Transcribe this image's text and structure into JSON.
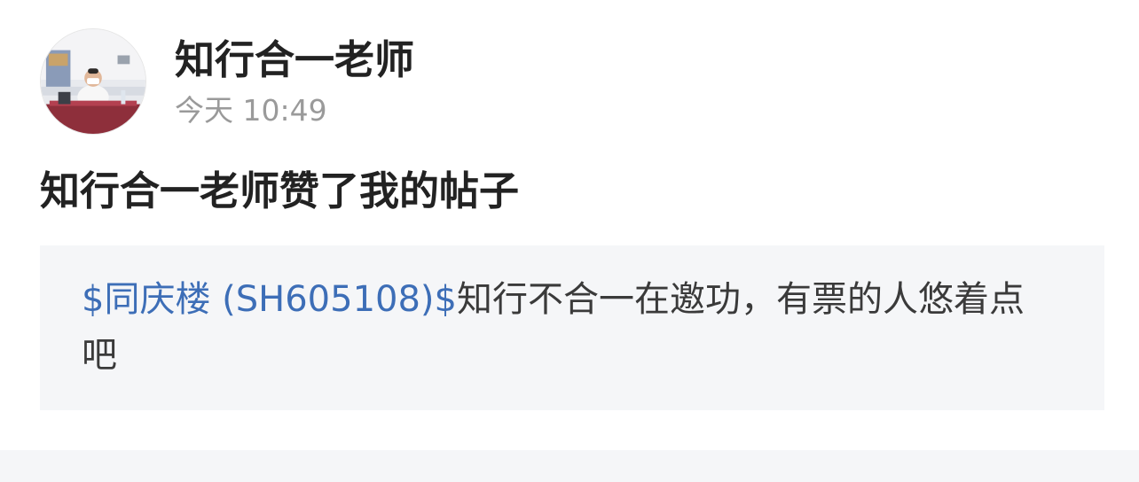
{
  "author": {
    "name": "知行合一老师",
    "time": "今天 10:49"
  },
  "notification": {
    "text": "知行合一老师赞了我的帖子"
  },
  "post": {
    "stock_link": "$同庆楼 (SH605108)$",
    "body": "知行不合一在邀功，有票的人悠着点吧"
  },
  "colors": {
    "link": "#3d6eb7",
    "quote_background": "#f5f6f8",
    "timestamp": "#9a9a9a"
  }
}
